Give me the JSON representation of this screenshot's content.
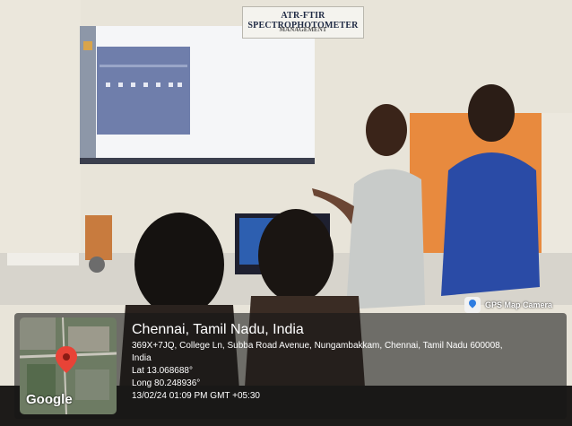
{
  "scene": {
    "sign": {
      "title": "ATR-FTIR SPECTROPHOTOMETER",
      "subtitle": "MANAGEMENT"
    }
  },
  "gps_stamp": {
    "badge_label": "GPS Map Camera",
    "location_title": "Chennai, Tamil Nadu, India",
    "address": "369X+7JQ, College Ln, Subba Road Avenue, Nungambakkam, Chennai, Tamil Nadu 600008,",
    "country": "India",
    "latitude": "Lat 13.068688°",
    "longitude": "Long 80.248936°",
    "datetime": "13/02/24 01:09 PM GMT +05:30",
    "map_watermark": "Google"
  },
  "icons": {
    "badge": "gps-map-camera-icon",
    "map_marker": "map-pin-icon"
  },
  "colors": {
    "wall": "#e9e5da",
    "projection": "#f5f6f8",
    "orange_panel": "#e88a3e",
    "blue_shirt": "#2a4ba6",
    "gray_shirt": "#c8cbc9",
    "overlay": "#222222",
    "pin": "#e84337"
  }
}
